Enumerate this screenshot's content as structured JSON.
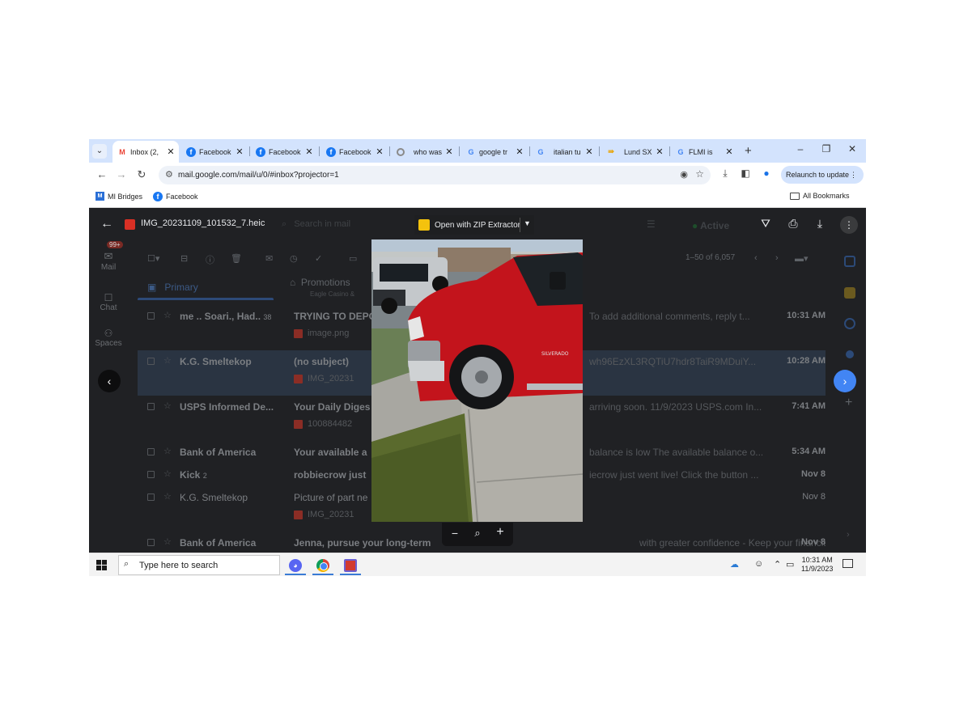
{
  "browser": {
    "tab_search_icon": "chevron-down-icon",
    "tabs": [
      {
        "label": "Inbox (2,",
        "icon": "gmail-icon",
        "active": true
      },
      {
        "label": "Facebook",
        "icon": "facebook-icon"
      },
      {
        "label": "Facebook",
        "icon": "facebook-icon"
      },
      {
        "label": "Facebook",
        "icon": "facebook-icon"
      },
      {
        "label": "who was",
        "icon": "loading-icon"
      },
      {
        "label": "google tr",
        "icon": "google-icon"
      },
      {
        "label": "italian tu",
        "icon": "google-icon"
      },
      {
        "label": "Lund SX",
        "icon": "lund-icon"
      },
      {
        "label": "FLMI is",
        "icon": "google-icon"
      }
    ],
    "new_tab": "+",
    "window_controls": {
      "minimize": "–",
      "restore": "❐",
      "close": "✕"
    },
    "url": "mail.google.com/mail/u/0/#inbox?projector=1",
    "relaunch_label": "Relaunch to update",
    "bookmarks": [
      {
        "label": "MI Bridges",
        "icon": "mibridges-icon"
      },
      {
        "label": "Facebook",
        "icon": "facebook-icon"
      }
    ],
    "all_bookmarks": "All Bookmarks"
  },
  "viewer": {
    "file_name": "IMG_20231109_101532_7.heic",
    "open_with": "Open with ZIP Extractor",
    "zoom": {
      "out": "−",
      "reset": "⌕",
      "in": "+"
    }
  },
  "gmail": {
    "search_placeholder": "Search in mail",
    "status": "Active",
    "rail": [
      {
        "label": "Mail",
        "badge": "99+"
      },
      {
        "label": "Chat"
      },
      {
        "label": "Spaces"
      }
    ],
    "count_label": "1–50 of 6,057",
    "tabs": [
      {
        "label": "Primary"
      },
      {
        "label": "Promotions",
        "sub": "Eagle Casino &"
      }
    ],
    "emails": [
      {
        "sender": "me .. Soari., Had..",
        "count": "38",
        "subject": "TRYING TO DEPO",
        "snippet": "To add additional comments, reply t...",
        "time": "10:31 AM",
        "attachment": "image.png",
        "unread": true,
        "selected": false
      },
      {
        "sender": "K.G. Smeltekop",
        "subject": "(no subject)",
        "snippet": "wh96EzXL3RQTiU7hdr8TaiR9MDuiY...",
        "time": "10:28 AM",
        "attachment": "IMG_20231",
        "unread": true,
        "selected": true
      },
      {
        "sender": "USPS Informed De...",
        "subject": "Your Daily Diges",
        "snippet": "arriving soon. 11/9/2023 USPS.com In...",
        "time": "7:41 AM",
        "attachment": "100884482",
        "unread": true,
        "selected": false
      },
      {
        "sender": "Bank of America",
        "subject": "Your available a",
        "snippet": "balance is low The available balance o...",
        "time": "5:34 AM",
        "unread": true,
        "selected": false
      },
      {
        "sender": "Kick",
        "count": "2",
        "subject": "robbiecrow just",
        "snippet": "iecrow just went live! Click the button ...",
        "time": "Nov 8",
        "unread": true,
        "selected": false
      },
      {
        "sender": "K.G. Smeltekop",
        "subject": "Picture of part ne",
        "snippet": "",
        "time": "Nov 8",
        "attachment": "IMG_20231",
        "unread": false,
        "selected": false
      },
      {
        "sender": "Bank of America",
        "subject": "Jenna, pursue your long-term",
        "snippet": "with greater confidence - Keep your financial goals i...",
        "time": "Nov 8",
        "unread": true,
        "selected": false
      }
    ]
  },
  "taskbar": {
    "search_placeholder": "Type here to search",
    "time": "10:31 AM",
    "date": "11/9/2023",
    "apps": [
      "discord-icon",
      "chrome-icon",
      "app-icon"
    ]
  }
}
